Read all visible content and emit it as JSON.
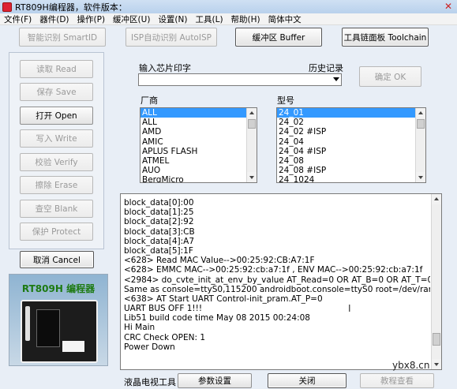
{
  "window": {
    "title": "RT809H编程器，软件版本：",
    "close_glyph": "✕"
  },
  "menu": [
    "文件(F)",
    "器件(D)",
    "操作(P)",
    "缓冲区(U)",
    "设置(N)",
    "工具(L)",
    "帮助(H)",
    "简体中文"
  ],
  "toolbar": {
    "smart_id": "智能识别 SmartID",
    "isp_auto": "ISP自动识别 AutoISP",
    "buffer": "缓冲区 Buffer",
    "toolchain": "工具链面板 Toolchain"
  },
  "side_buttons": [
    "读取 Read",
    "保存 Save",
    "打开 Open",
    "写入 Write",
    "校验 Verify",
    "擦除 Erase",
    "查空 Blank",
    "保护 Protect"
  ],
  "cancel_label": "取消 Cancel",
  "device_image": {
    "brand": "RT809H 编程器"
  },
  "chip_input": {
    "label": "输入芯片印字",
    "history_label": "历史记录",
    "value": ""
  },
  "ok_label": "确定 OK",
  "vendor": {
    "label": "厂商",
    "items": [
      "ALL",
      "ALL",
      "AMD",
      "AMIC",
      "APLUS FLASH",
      "ATMEL",
      "AUO",
      "BergMicro"
    ],
    "selected": 0
  },
  "model": {
    "label": "型号",
    "items": [
      "24_01",
      "24_02",
      "24_02 #ISP",
      "24_04",
      "24_04 #ISP",
      "24_08",
      "24_08 #ISP",
      "24_1024"
    ],
    "selected": 0
  },
  "log_lines": [
    "block_data[0]:00",
    "block_data[1]:25",
    "block_data[2]:92",
    "block_data[3]:CB",
    "block_data[4]:A7",
    "block_data[5]:1F",
    "<628> Read MAC Value-->00:25:92:CB:A7:1F",
    "<628> EMMC MAC-->00:25:92:cb:a7:1f , ENV MAC-->00:25:92:cb:a7:1f",
    "<2984> do_cvte_init_at_env_by_value AT_Read=0 OR AT_B=0 OR AT_T=0 AT_BOOTC",
    "Same as console=ttyS0,115200 androidboot.console=ttyS0 root=/dev/ram rw rootwait ir",
    "<638> AT Start UART Control-init_pram.AT_P=0",
    " UART BUS OFF 1!!!",
    "Lib51 build code time May 08 2015  00:24:08",
    "Hi Main",
    "CRC Check OPEN: 1",
    "Power Down"
  ],
  "bottom": {
    "lcd_tool": "液晶电视工具",
    "params": "参数设置",
    "close": "关闭",
    "tutorial": "教程查看"
  },
  "watermark": "ybx8.cn"
}
